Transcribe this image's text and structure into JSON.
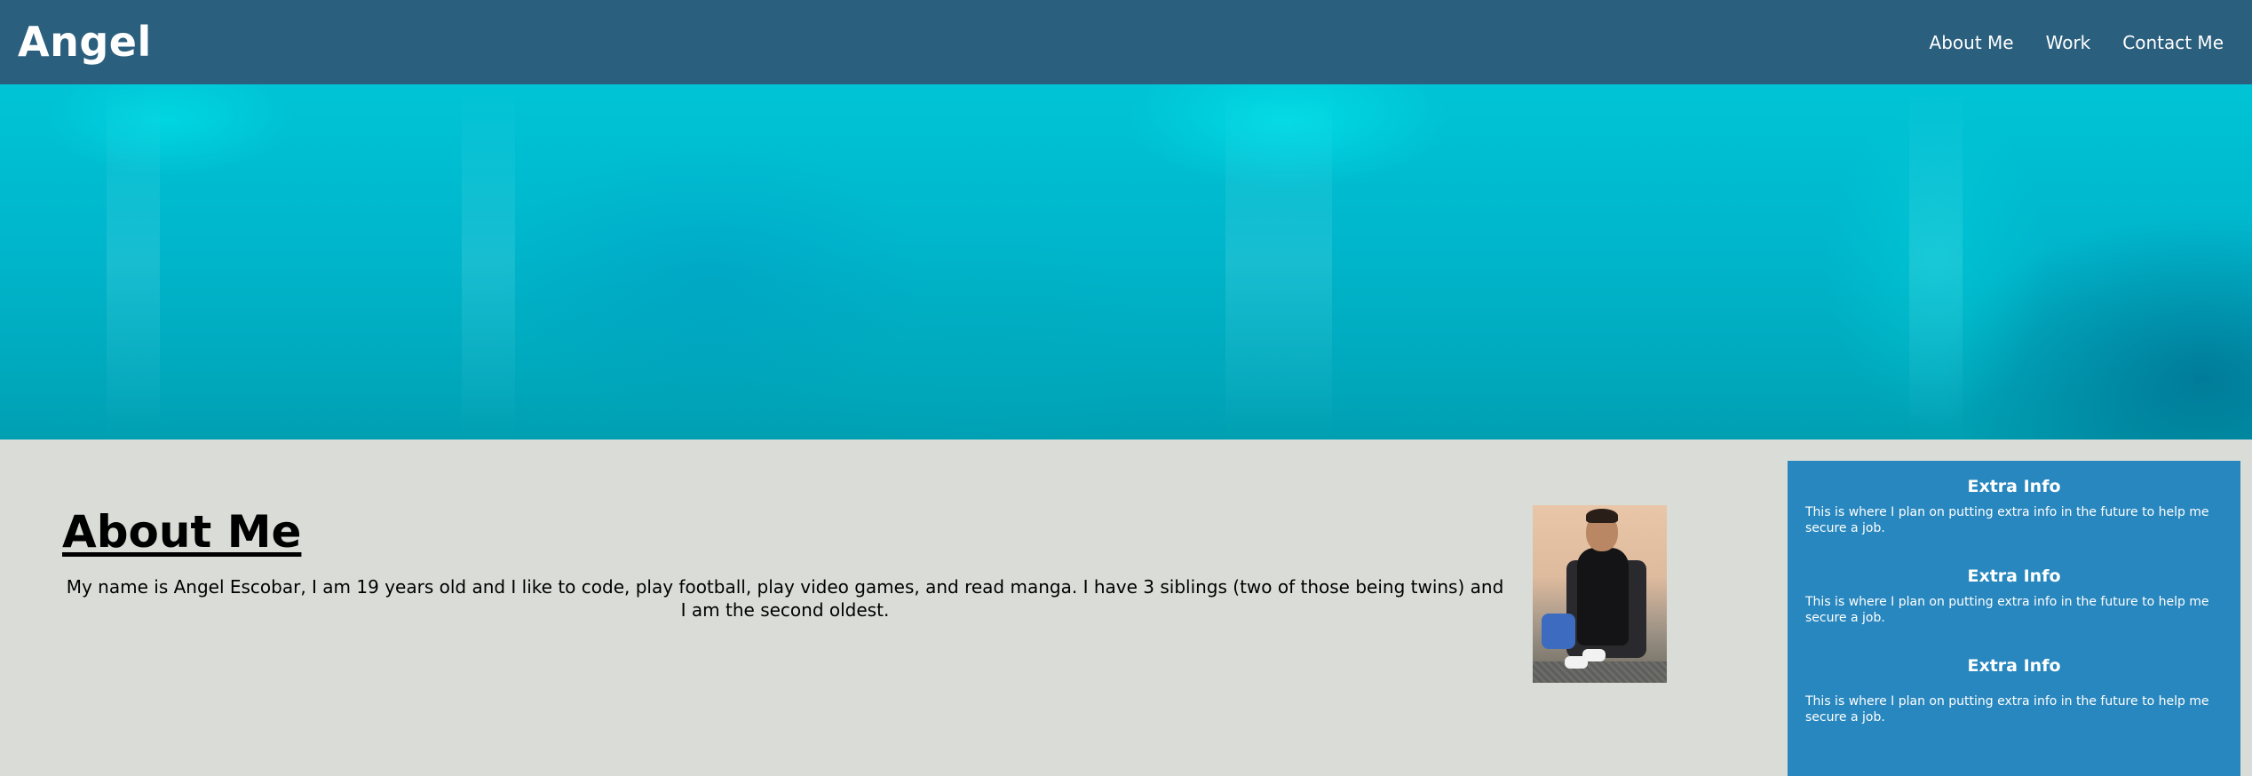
{
  "header": {
    "brand": "Angel",
    "nav": [
      "About Me",
      "Work",
      "Contact Me"
    ]
  },
  "about": {
    "title": "About Me",
    "text": "My name is Angel Escobar, I am 19 years old and I like to code, play football, play video games, and read manga. I have 3 siblings (two of those being twins) and I am the second oldest."
  },
  "sidebar": {
    "blocks": [
      {
        "title": "Extra Info",
        "text": "This is where I plan on putting extra info in the future to help me secure a job."
      },
      {
        "title": "Extra Info",
        "text": "This is where I plan on putting extra info in the future to help me secure a job."
      },
      {
        "title": "Extra Info",
        "text": "This is where I plan on putting extra info in the future to help me secure a job."
      }
    ]
  },
  "colors": {
    "header_bg": "#2b5f7e",
    "hero_bg": "#00b6cc",
    "page_bg": "#d9dcd7",
    "sidebar_bg": "#2887be"
  }
}
